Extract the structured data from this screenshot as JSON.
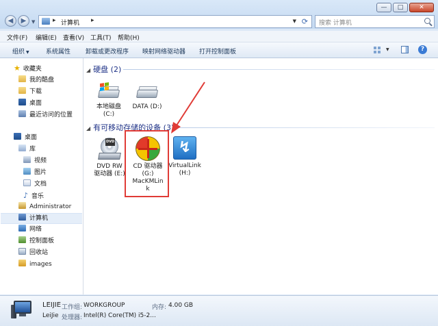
{
  "address": {
    "crumb": "计算机",
    "search_placeholder": "搜索 计算机"
  },
  "window_buttons": [
    "—",
    "□",
    "✕"
  ],
  "menubar": [
    "文件(F)",
    "编辑(E)",
    "查看(V)",
    "工具(T)",
    "帮助(H)"
  ],
  "toolbar": [
    "组织",
    "系统属性",
    "卸载或更改程序",
    "映射网络驱动器",
    "打开控制面板"
  ],
  "nav": {
    "favorites": "收藏夹",
    "favorites_items": [
      "我的酷盘",
      "下载",
      "桌面",
      "最近访问的位置"
    ],
    "desktop": "桌面",
    "library": "库",
    "library_items": [
      "视频",
      "图片",
      "文档",
      "音乐"
    ],
    "others": [
      "Administrator",
      "计算机",
      "网络",
      "控制面板",
      "回收站",
      "images"
    ]
  },
  "groups": {
    "hdd": "硬盘 (2)",
    "removable": "有可移动存储的设备 (3)"
  },
  "drives": {
    "local": [
      "本地磁盘",
      "(C:)"
    ],
    "data": [
      "DATA (D:)"
    ],
    "dvd": [
      "DVD RW",
      "驱动器 (E:)"
    ],
    "cd": [
      "CD 驱动器",
      "(G:)",
      "MacKMLin",
      "k"
    ],
    "vlink": [
      "VirtualLink",
      "(H:)"
    ]
  },
  "details": {
    "name": "LEIJIE",
    "user": "LeiJie",
    "workgroup_label": "工作组:",
    "workgroup_value": "WORKGROUP",
    "memory_label": "内存:",
    "memory_value": "4.00 GB",
    "cpu_label": "处理器:",
    "cpu_value": "Intel(R) Core(TM) i5-2..."
  },
  "colors": {
    "highlight": "#e03b36",
    "group_header": "#1e3287"
  }
}
